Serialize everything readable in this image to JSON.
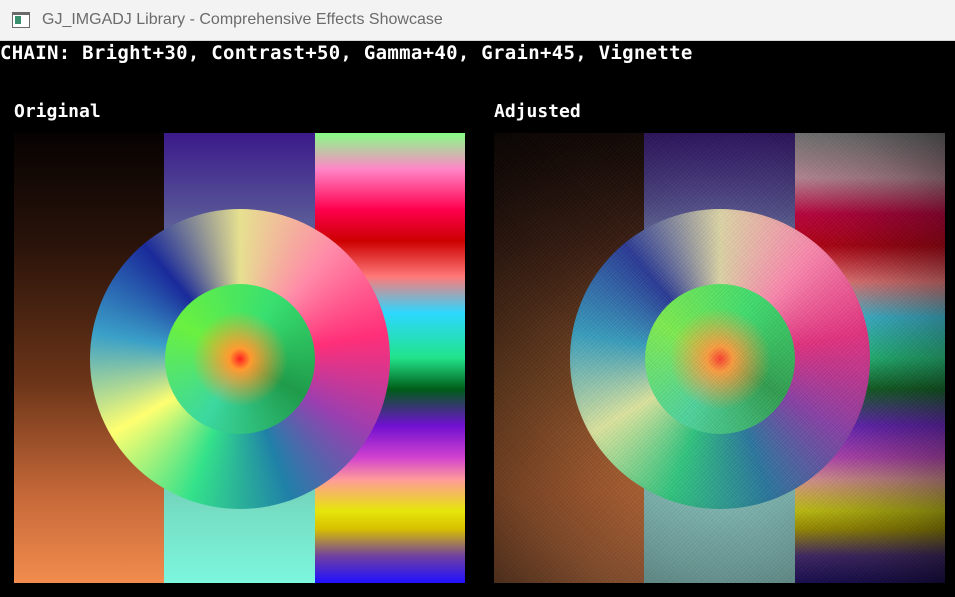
{
  "window": {
    "title": "GJ_IMGADJ Library - Comprehensive Effects Showcase",
    "icon": "app-window-icon"
  },
  "header": {
    "chain_text": "CHAIN: Bright+30, Contrast+50, Gamma+40, Grain+45, Vignette"
  },
  "panels": {
    "original": {
      "label": "Original"
    },
    "adjusted": {
      "label": "Adjusted"
    }
  },
  "colors": {
    "background": "#000000",
    "text": "#ffffff",
    "titlebar": "#f3f3f3",
    "title_text": "#6b6b6b"
  }
}
